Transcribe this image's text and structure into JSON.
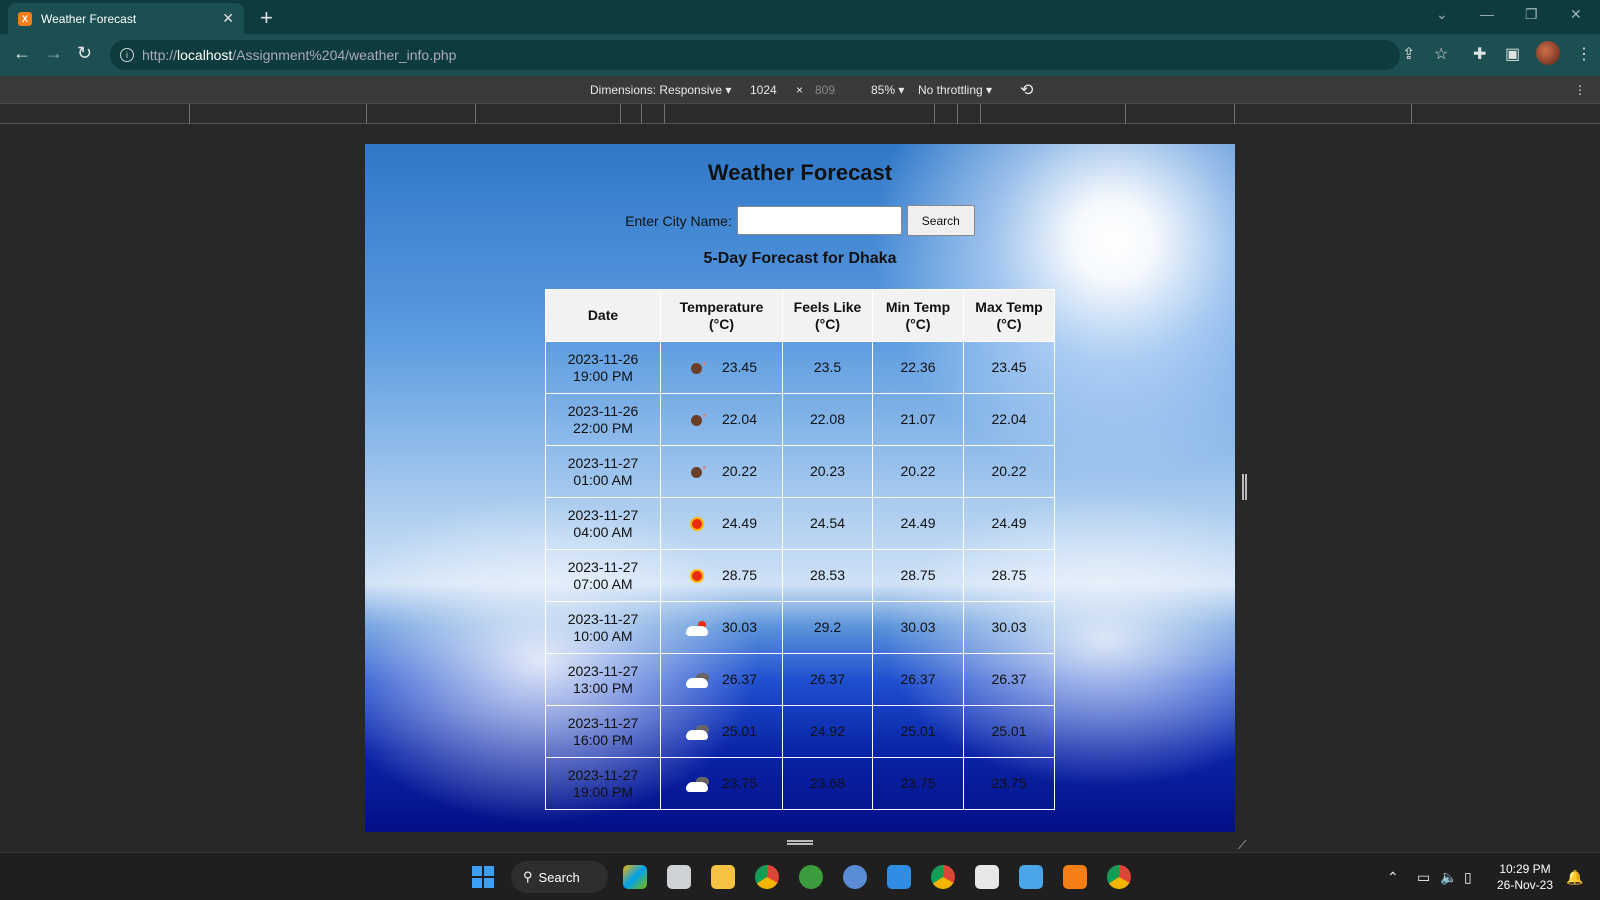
{
  "browser": {
    "tab_title": "Weather Forecast",
    "favicon_text": "X",
    "url_prefix": "http://",
    "url_host": "localhost",
    "url_path": "/Assignment%204/weather_info.php"
  },
  "devtools": {
    "dimensions_label": "Dimensions: Responsive",
    "width_value": "1024",
    "times": "×",
    "height_value": "809",
    "zoom": "85%",
    "throttling": "No throttling"
  },
  "page": {
    "title": "Weather Forecast",
    "city_label": "Enter City Name:",
    "city_value": "",
    "search_button": "Search",
    "forecast_title": "5-Day Forecast for Dhaka",
    "headers": {
      "date": "Date",
      "temperature": "Temperature (°C)",
      "feels_like": "Feels Like (°C)",
      "min_temp": "Min Temp (°C)",
      "max_temp": "Max Temp (°C)"
    },
    "rows": [
      {
        "date": "2023-11-26",
        "time": "19:00 PM",
        "icon": "moon",
        "temp": "23.45",
        "feels": "23.5",
        "min": "22.36",
        "max": "23.45"
      },
      {
        "date": "2023-11-26",
        "time": "22:00 PM",
        "icon": "moon",
        "temp": "22.04",
        "feels": "22.08",
        "min": "21.07",
        "max": "22.04"
      },
      {
        "date": "2023-11-27",
        "time": "01:00 AM",
        "icon": "moon",
        "temp": "20.22",
        "feels": "20.23",
        "min": "20.22",
        "max": "20.22"
      },
      {
        "date": "2023-11-27",
        "time": "04:00 AM",
        "icon": "sun",
        "temp": "24.49",
        "feels": "24.54",
        "min": "24.49",
        "max": "24.49"
      },
      {
        "date": "2023-11-27",
        "time": "07:00 AM",
        "icon": "sun",
        "temp": "28.75",
        "feels": "28.53",
        "min": "28.75",
        "max": "28.75"
      },
      {
        "date": "2023-11-27",
        "time": "10:00 AM",
        "icon": "cloud-sun",
        "temp": "30.03",
        "feels": "29.2",
        "min": "30.03",
        "max": "30.03"
      },
      {
        "date": "2023-11-27",
        "time": "13:00 PM",
        "icon": "cloud",
        "temp": "26.37",
        "feels": "26.37",
        "min": "26.37",
        "max": "26.37"
      },
      {
        "date": "2023-11-27",
        "time": "16:00 PM",
        "icon": "cloud",
        "temp": "25.01",
        "feels": "24.92",
        "min": "25.01",
        "max": "25.01"
      },
      {
        "date": "2023-11-27",
        "time": "19:00 PM",
        "icon": "cloud",
        "temp": "23.75",
        "feels": "23.68",
        "min": "23.75",
        "max": "23.75"
      }
    ]
  },
  "taskbar": {
    "search_label": "Search",
    "time": "10:29 PM",
    "date": "26-Nov-23"
  }
}
